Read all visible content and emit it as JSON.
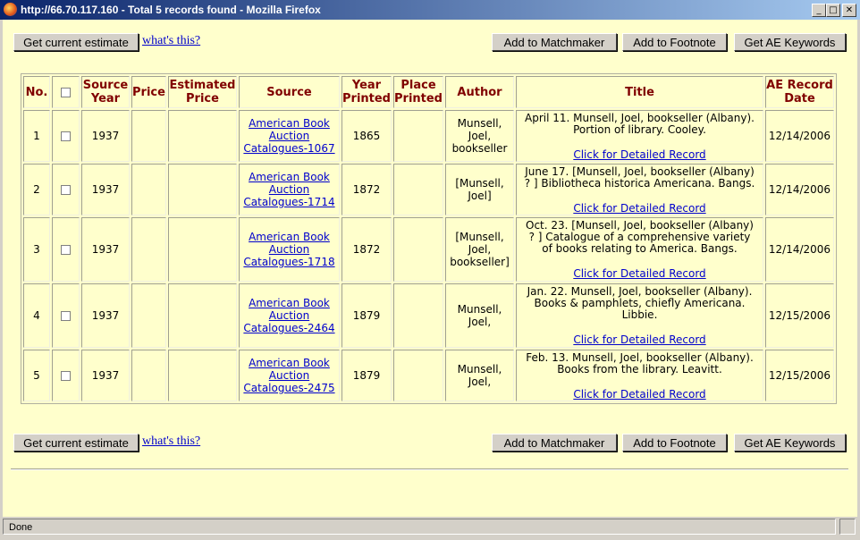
{
  "window": {
    "title": "http://66.70.117.160 - Total 5 records found - Mozilla Firefox",
    "minimize": "_",
    "maximize": "□",
    "close": "✕"
  },
  "toolbar": {
    "estimate_label": "Get current estimate",
    "whats_this": "what's this?",
    "matchmaker_label": "Add to Matchmaker",
    "footnote_label": "Add to Footnote",
    "keywords_label": "Get AE Keywords"
  },
  "table": {
    "headers": {
      "no": "No.",
      "source_year_1": "Source",
      "source_year_2": "Year",
      "price": "Price",
      "estimated_1": "Estimated",
      "estimated_2": "Price",
      "source": "Source",
      "year_printed_1": "Year",
      "year_printed_2": "Printed",
      "place_printed_1": "Place",
      "place_printed_2": "Printed",
      "author": "Author",
      "title": "Title",
      "ae_date_1": "AE Record",
      "ae_date_2": "Date"
    },
    "detail_link": "Click for Detailed Record",
    "rows": [
      {
        "no": "1",
        "source_year": "1937",
        "price": "",
        "estimated_price": "",
        "source_1": "American Book",
        "source_2": "Auction",
        "source_3": "Catalogues-1067",
        "year_printed": "1865",
        "place_printed": "",
        "author_1": "Munsell,",
        "author_2": "Joel,",
        "author_3": "bookseller",
        "title_1": "April 11. Munsell, Joel, bookseller (Albany).",
        "title_2": "Portion of library. Cooley.",
        "title_3": "",
        "ae_date": "12/14/2006"
      },
      {
        "no": "2",
        "source_year": "1937",
        "price": "",
        "estimated_price": "",
        "source_1": "American Book",
        "source_2": "Auction",
        "source_3": "Catalogues-1714",
        "year_printed": "1872",
        "place_printed": "",
        "author_1": "[Munsell,",
        "author_2": "Joel]",
        "author_3": "",
        "title_1": "June 17. [Munsell, Joel, bookseller (Albany)",
        "title_2": "? ] Bibliotheca historica Americana. Bangs.",
        "title_3": "",
        "ae_date": "12/14/2006"
      },
      {
        "no": "3",
        "source_year": "1937",
        "price": "",
        "estimated_price": "",
        "source_1": "American Book",
        "source_2": "Auction",
        "source_3": "Catalogues-1718",
        "year_printed": "1872",
        "place_printed": "",
        "author_1": "[Munsell,",
        "author_2": "Joel,",
        "author_3": "bookseller]",
        "title_1": "Oct. 23. [Munsell, Joel, bookseller (Albany)",
        "title_2": "? ] Catalogue of a comprehensive variety",
        "title_3": "of books relating to America. Bangs.",
        "ae_date": "12/14/2006"
      },
      {
        "no": "4",
        "source_year": "1937",
        "price": "",
        "estimated_price": "",
        "source_1": "American Book",
        "source_2": "Auction",
        "source_3": "Catalogues-2464",
        "year_printed": "1879",
        "place_printed": "",
        "author_1": "Munsell,",
        "author_2": "Joel,",
        "author_3": "",
        "title_1": "Jan. 22. Munsell, Joel, bookseller (Albany).",
        "title_2": "Books & pamphlets, chiefly Americana.",
        "title_3": "Libbie.",
        "ae_date": "12/15/2006"
      },
      {
        "no": "5",
        "source_year": "1937",
        "price": "",
        "estimated_price": "",
        "source_1": "American Book",
        "source_2": "Auction",
        "source_3": "Catalogues-2475",
        "year_printed": "1879",
        "place_printed": "",
        "author_1": "Munsell,",
        "author_2": "Joel,",
        "author_3": "",
        "title_1": "Feb. 13. Munsell, Joel, bookseller (Albany).",
        "title_2": "Books from the library. Leavitt.",
        "title_3": "",
        "ae_date": "12/15/2006"
      }
    ]
  },
  "status": {
    "text": "Done"
  }
}
